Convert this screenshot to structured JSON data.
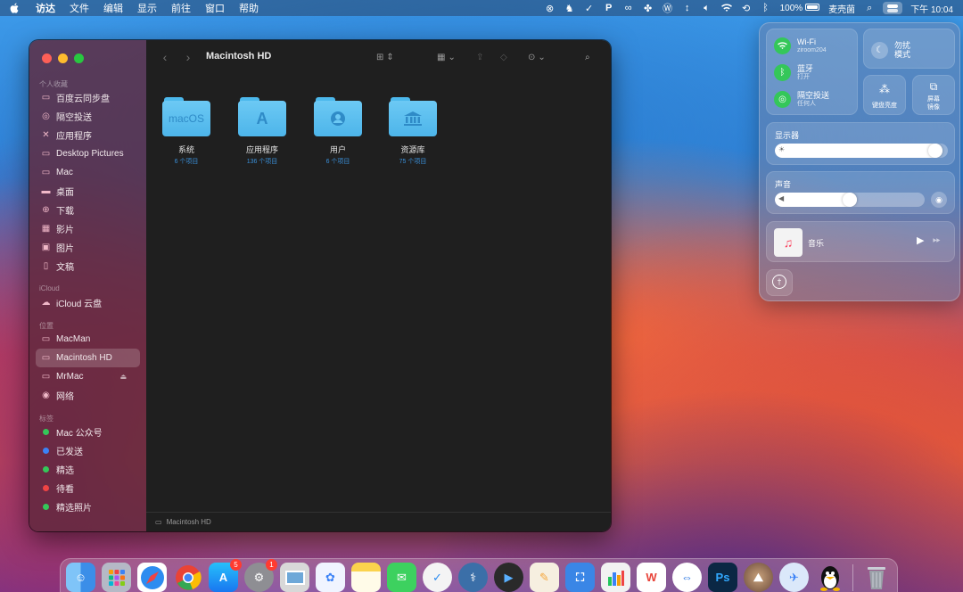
{
  "menubar": {
    "app_name": "访达",
    "menus": [
      "文件",
      "编辑",
      "显示",
      "前往",
      "窗口",
      "帮助"
    ],
    "status_icons": [
      "close-circle-icon",
      "qq-icon",
      "check-circle-icon",
      "p-icon",
      "glasses-icon",
      "fan-icon",
      "wordpress-icon",
      "updown-icon",
      "volume-icon",
      "wifi-icon",
      "sync-icon",
      "bluetooth-icon"
    ],
    "battery": "100%",
    "user": "麦壳菌",
    "clock": "下午 10:04"
  },
  "finder": {
    "title": "Macintosh HD",
    "sidebar": {
      "favorites_header": "个人收藏",
      "favorites": [
        {
          "label": "百度云同步盘",
          "icon": "folder-icon"
        },
        {
          "label": "隔空投送",
          "icon": "airdrop-icon"
        },
        {
          "label": "应用程序",
          "icon": "applications-icon"
        },
        {
          "label": "Desktop Pictures",
          "icon": "folder-icon"
        },
        {
          "label": "Mac",
          "icon": "folder-icon"
        },
        {
          "label": "桌面",
          "icon": "desktop-icon"
        },
        {
          "label": "下载",
          "icon": "download-icon"
        },
        {
          "label": "影片",
          "icon": "movies-icon"
        },
        {
          "label": "图片",
          "icon": "pictures-icon"
        },
        {
          "label": "文稿",
          "icon": "document-icon"
        }
      ],
      "icloud_header": "iCloud",
      "icloud": [
        {
          "label": "iCloud 云盘",
          "icon": "cloud-icon"
        }
      ],
      "locations_header": "位置",
      "locations": [
        {
          "label": "MacMan",
          "icon": "computer-icon"
        },
        {
          "label": "Macintosh HD",
          "icon": "disk-icon"
        },
        {
          "label": "MrMac",
          "icon": "disk-icon"
        },
        {
          "label": "网络",
          "icon": "network-icon"
        }
      ],
      "tags_header": "标签",
      "tags": [
        {
          "label": "Mac 公众号",
          "color": "#34c759"
        },
        {
          "label": "已发送",
          "color": "#3b82f6"
        },
        {
          "label": "精选",
          "color": "#34c759"
        },
        {
          "label": "待看",
          "color": "#ef4444"
        },
        {
          "label": "精选照片",
          "color": "#34c759"
        }
      ]
    },
    "files": [
      {
        "name": "系统",
        "count": "6 个项目",
        "glyph": "macOS"
      },
      {
        "name": "应用程序",
        "count": "136 个项目",
        "glyph": "A"
      },
      {
        "name": "用户",
        "count": "6 个项目",
        "glyph": "user"
      },
      {
        "name": "资源库",
        "count": "75 个项目",
        "glyph": "library"
      }
    ],
    "pathbar": "Macintosh HD"
  },
  "control_center": {
    "wifi": {
      "title": "Wi-Fi",
      "sub": "ziroom204"
    },
    "bluetooth": {
      "title": "蓝牙",
      "sub": "打开"
    },
    "airdrop": {
      "title": "隔空投送",
      "sub": "任何人"
    },
    "dnd": {
      "title": "勿扰",
      "sub": "模式"
    },
    "keyboard_brightness": "键盘亮度",
    "screen_mirroring_1": "屏幕",
    "screen_mirroring_2": "镜像",
    "display_label": "显示器",
    "display_level": 0.97,
    "sound_label": "声音",
    "sound_level": 0.55,
    "music_label": "音乐"
  },
  "dock": {
    "apps": [
      {
        "name": "finder-icon",
        "color": "#3b9ef0"
      },
      {
        "name": "launchpad-icon",
        "color": "#b5b9c6"
      },
      {
        "name": "safari-icon",
        "color": "#2d8cf0"
      },
      {
        "name": "chrome-icon",
        "color": "#e8e8e8"
      },
      {
        "name": "app-store-icon",
        "color": "#2f8cf2",
        "badge": "5"
      },
      {
        "name": "system-preferences-icon",
        "color": "#8e8e93",
        "badge": "1"
      },
      {
        "name": "preview-icon",
        "color": "#d8d8d8"
      },
      {
        "name": "baidu-netdisk-icon",
        "color": "#f0f4ff"
      },
      {
        "name": "notes-icon",
        "color": "#fbd34d"
      },
      {
        "name": "wechat-icon",
        "color": "#3dd15f"
      },
      {
        "name": "things-icon",
        "color": "#f4f4f4"
      },
      {
        "name": "disk-utility-icon",
        "color": "#3b6fa8"
      },
      {
        "name": "infuse-icon",
        "color": "#2a2a2a"
      },
      {
        "name": "pages-icon",
        "color": "#f4a53a"
      },
      {
        "name": "keynote-icon",
        "color": "#3a86e6"
      },
      {
        "name": "numbers-icon",
        "color": "#f2f2f2"
      },
      {
        "name": "wps-icon",
        "color": "#e8443a"
      },
      {
        "name": "teamviewer-icon",
        "color": "#1e6fe0"
      },
      {
        "name": "photoshop-icon",
        "color": "#0b2744"
      },
      {
        "name": "macos-installer-icon",
        "color": "#8a5a44"
      },
      {
        "name": "testflight-icon",
        "color": "#8fb4e8"
      },
      {
        "name": "qq-icon",
        "color": "#fbfbfb"
      },
      {
        "name": "trash-icon",
        "color": "#9aa0a8"
      }
    ]
  }
}
